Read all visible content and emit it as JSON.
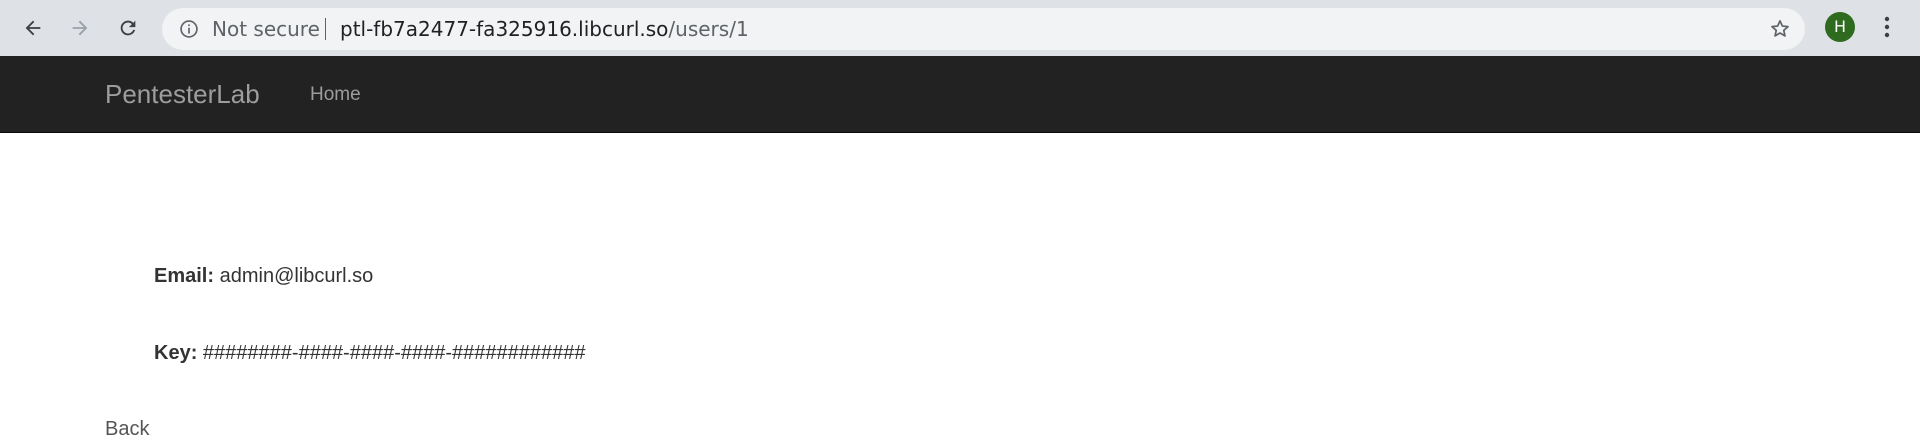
{
  "browser": {
    "security_label": "Not secure",
    "url_host": "ptl-fb7a2477-fa325916.libcurl.so",
    "url_path": "/users/1",
    "profile_initial": "H",
    "profile_color": "#2e6b1f"
  },
  "navbar": {
    "brand": "PentesterLab",
    "links": [
      {
        "label": "Home"
      }
    ]
  },
  "user": {
    "email_label": "Email:",
    "email_value": "admin@libcurl.so",
    "key_label": "Key:",
    "key_value": "########-####-####-####-############"
  },
  "footer": {
    "back_label": "Back"
  }
}
